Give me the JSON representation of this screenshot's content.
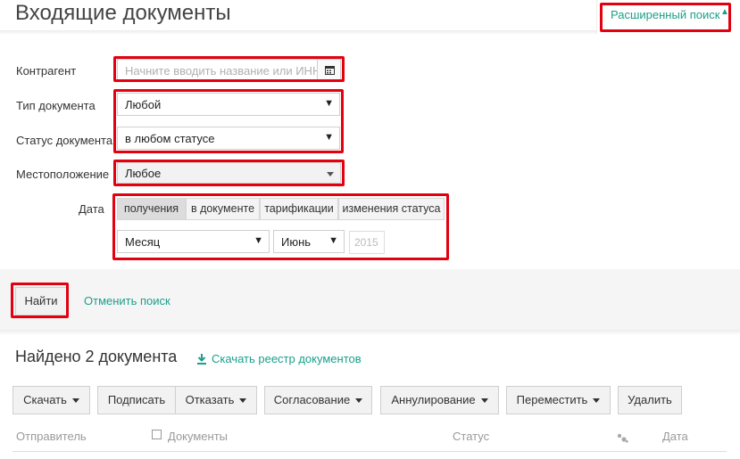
{
  "header": {
    "title": "Входящие документы",
    "advanced_search_label": "Расширенный поиск",
    "advanced_search_arrow": "▲"
  },
  "filters": {
    "counterparty": {
      "label": "Контрагент",
      "placeholder": "Начните вводить название или ИНН"
    },
    "doc_type": {
      "label": "Тип документа",
      "value": "Любой"
    },
    "doc_status": {
      "label": "Статус документа",
      "value": "в любом статусе"
    },
    "location": {
      "label": "Местоположение",
      "value": "Любое"
    },
    "date": {
      "label": "Дата",
      "tabs": [
        "получения",
        "в документе",
        "тарификации",
        "изменения статуса"
      ],
      "active_tab": "получения",
      "period": "Месяц",
      "month": "Июнь",
      "year_placeholder": "2015"
    }
  },
  "actions": {
    "find_label": "Найти",
    "cancel_label": "Отменить поиск"
  },
  "results": {
    "found_text": "Найдено 2 документа",
    "download_registry": "Скачать реестр документов"
  },
  "toolbar": {
    "download": "Скачать",
    "sign": "Подписать",
    "refuse": "Отказать",
    "approval": "Согласование",
    "annul": "Аннулирование",
    "move": "Переместить",
    "delete": "Удалить"
  },
  "table": {
    "headers": {
      "sender": "Отправитель",
      "documents": "Документы",
      "status": "Статус",
      "date": "Дата"
    }
  },
  "colors": {
    "accent": "#1aa089",
    "highlight": "#e3000f"
  }
}
